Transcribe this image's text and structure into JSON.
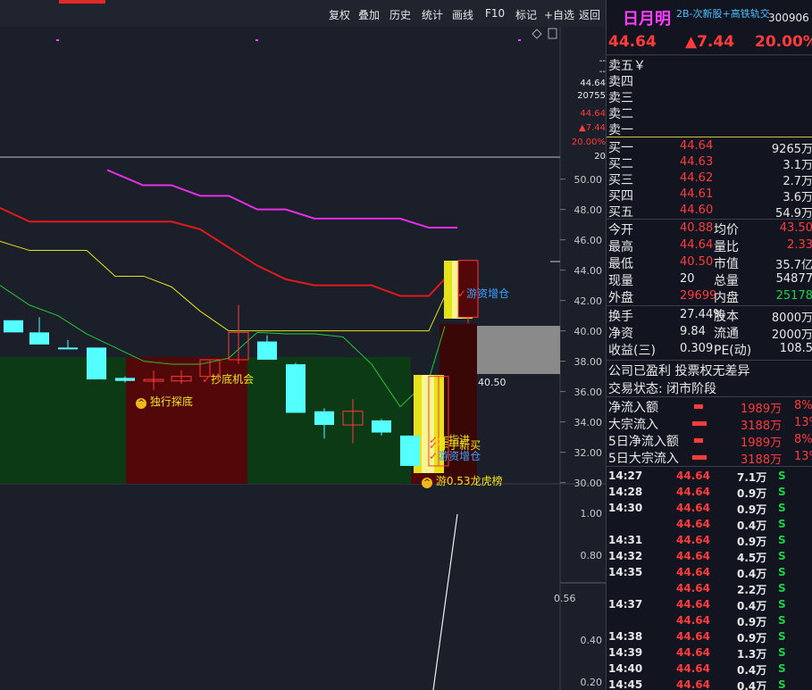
{
  "toolbar": {
    "items": [
      "复权",
      "叠加",
      "历史",
      "统计",
      "画线",
      "F10",
      "标记",
      "+自选",
      "返回"
    ]
  },
  "stock": {
    "name": "日月明",
    "tags": "2B-次新股+高铁轨交",
    "code": "300906",
    "price": "44.64",
    "change": "▲7.44",
    "pct": "20.00%"
  },
  "chart_info": {
    "dashes": [
      "--",
      "--"
    ],
    "values": [
      "44.64",
      "20755",
      "44.64",
      "▲7.44",
      "20.00%",
      "20"
    ]
  },
  "price_axis": [
    "50.00",
    "48.00",
    "46.00",
    "44.00",
    "42.00",
    "40.00",
    "38.00",
    "36.00",
    "34.00",
    "32.00",
    "30.00"
  ],
  "sub_axis": [
    "1.00",
    "0.80",
    "0.56",
    "0.40",
    "0.20"
  ],
  "signals": {
    "dujia": "独行探底",
    "chaodi": "抄底机会",
    "youzi1": "游资增仓",
    "zuoshou": "作手新买",
    "baoyi": "作指进",
    "youzi2": "游资增仓",
    "longhu": "龙虎榜",
    "price_label": "40.50",
    "extra": "游0.53"
  },
  "orderbook": {
    "sell": [
      {
        "label": "卖五",
        "price": "￥",
        "vol": ""
      },
      {
        "label": "卖四",
        "price": "",
        "vol": ""
      },
      {
        "label": "卖三",
        "price": "",
        "vol": ""
      },
      {
        "label": "卖二",
        "price": "",
        "vol": ""
      },
      {
        "label": "卖一",
        "price": "",
        "vol": ""
      }
    ],
    "buy": [
      {
        "label": "买一",
        "price": "44.64",
        "vol": "9265万"
      },
      {
        "label": "买二",
        "price": "44.63",
        "vol": "3.1万"
      },
      {
        "label": "买三",
        "price": "44.62",
        "vol": "2.7万"
      },
      {
        "label": "买四",
        "price": "44.61",
        "vol": "3.6万"
      },
      {
        "label": "买五",
        "price": "44.60",
        "vol": "54.9万"
      }
    ]
  },
  "stats": [
    {
      "l1": "今开",
      "v1": "40.88",
      "c1": "red",
      "l2": "均价",
      "v2": "43.50",
      "c2": "red"
    },
    {
      "l1": "最高",
      "v1": "44.64",
      "c1": "red",
      "l2": "量比",
      "v2": "2.33",
      "c2": "red"
    },
    {
      "l1": "最低",
      "v1": "40.50",
      "c1": "red",
      "l2": "市值",
      "v2": "35.7亿",
      "c2": "white"
    },
    {
      "l1": "现量",
      "v1": "20",
      "c1": "white",
      "l2": "总量",
      "v2": "54877",
      "c2": "white"
    },
    {
      "l1": "外盘",
      "v1": "29699",
      "c1": "red",
      "l2": "内盘",
      "v2": "25178",
      "c2": "green"
    }
  ],
  "stats2": [
    {
      "l1": "换手",
      "v1": "27.44%",
      "l2": "股本",
      "v2": "8000万"
    },
    {
      "l1": "净资",
      "v1": "9.84",
      "l2": "流通",
      "v2": "2000万"
    },
    {
      "l1": "收益(三)",
      "v1": "0.309",
      "l2": "PE(动)",
      "v2": "108.5"
    }
  ],
  "notes": {
    "line1": "公司已盈利 投票权无差异",
    "line2": "交易状态: 闭市阶段"
  },
  "flows": [
    {
      "label": "净流入额",
      "value": "1989万",
      "pct": "8%"
    },
    {
      "label": "大宗流入",
      "value": "3188万",
      "pct": "13%"
    },
    {
      "label": "5日净流入额",
      "value": "1989万",
      "pct": "8%"
    },
    {
      "label": "5日大宗流入",
      "value": "3188万",
      "pct": "13%"
    }
  ],
  "ticks": [
    {
      "time": "14:27",
      "price": "44.64",
      "vol": "7.1万",
      "side": "S"
    },
    {
      "time": "14:28",
      "price": "44.64",
      "vol": "0.9万",
      "side": "S"
    },
    {
      "time": "14:30",
      "price": "44.64",
      "vol": "0.9万",
      "side": "S"
    },
    {
      "time": "",
      "price": "44.64",
      "vol": "0.4万",
      "side": "S"
    },
    {
      "time": "14:31",
      "price": "44.64",
      "vol": "0.9万",
      "side": "S"
    },
    {
      "time": "14:32",
      "price": "44.64",
      "vol": "4.5万",
      "side": "S"
    },
    {
      "time": "14:35",
      "price": "44.64",
      "vol": "0.4万",
      "side": "S"
    },
    {
      "time": "",
      "price": "44.64",
      "vol": "2.2万",
      "side": "S"
    },
    {
      "time": "14:37",
      "price": "44.64",
      "vol": "0.4万",
      "side": "S"
    },
    {
      "time": "",
      "price": "44.64",
      "vol": "0.9万",
      "side": "S"
    },
    {
      "time": "14:38",
      "price": "44.64",
      "vol": "0.9万",
      "side": "S"
    },
    {
      "time": "14:39",
      "price": "44.64",
      "vol": "1.3万",
      "side": "S"
    },
    {
      "time": "14:40",
      "price": "44.64",
      "vol": "0.4万",
      "side": "S"
    },
    {
      "time": "14:45",
      "price": "44.64",
      "vol": "0.4万",
      "side": "S"
    }
  ],
  "colors": {
    "up": "#ff3b3b",
    "down": "#1cd14a",
    "bg": "#1b1f29",
    "panel": "#121520"
  },
  "chart_data": {
    "type": "candlestick",
    "y_range": [
      30,
      50.6
    ],
    "candles": [
      {
        "x": 4,
        "open": 40.7,
        "close": 39.9,
        "high": 40.7,
        "low": 39.9
      },
      {
        "x": 33,
        "open": 39.9,
        "close": 39.1,
        "high": 40.9,
        "low": 39.1
      },
      {
        "x": 65,
        "open": 38.9,
        "close": 38.8,
        "high": 39.4,
        "low": 38.8
      },
      {
        "x": 97,
        "open": 38.9,
        "close": 36.8,
        "high": 38.9,
        "low": 36.8
      },
      {
        "x": 129,
        "open": 36.9,
        "close": 36.7,
        "high": 37.0,
        "low": 36.6
      },
      {
        "x": 161,
        "open": 36.7,
        "close": 36.8,
        "high": 37.4,
        "low": 36.1
      },
      {
        "x": 192,
        "open": 36.7,
        "close": 37.0,
        "high": 37.4,
        "low": 36.5
      },
      {
        "x": 224,
        "open": 37.0,
        "close": 38.1,
        "high": 38.1,
        "low": 37.0
      },
      {
        "x": 256,
        "open": 38.1,
        "close": 39.9,
        "high": 41.7,
        "low": 37.8
      },
      {
        "x": 288,
        "open": 39.3,
        "close": 38.1,
        "high": 39.7,
        "low": 38.1
      },
      {
        "x": 320,
        "open": 37.8,
        "close": 34.6,
        "high": 37.9,
        "low": 34.6
      },
      {
        "x": 352,
        "open": 34.7,
        "close": 33.8,
        "high": 34.9,
        "low": 32.9
      },
      {
        "x": 384,
        "open": 33.8,
        "close": 34.7,
        "high": 35.5,
        "low": 32.6
      },
      {
        "x": 416,
        "open": 34.1,
        "close": 33.3,
        "high": 34.2,
        "low": 33.1
      },
      {
        "x": 448,
        "open": 33.1,
        "close": 31.1,
        "high": 33.1,
        "low": 31.1
      },
      {
        "x": 480,
        "open": 31.1,
        "close": 37.0,
        "high": 37.0,
        "low": 31.1
      },
      {
        "x": 513,
        "open": 40.9,
        "close": 44.64,
        "high": 44.64,
        "low": 40.5
      }
    ],
    "lines": {
      "magenta": [
        [
          120,
          50.6
        ],
        [
          160,
          49.6
        ],
        [
          192,
          49.6
        ],
        [
          224,
          48.9
        ],
        [
          256,
          48.9
        ],
        [
          288,
          48.0
        ],
        [
          320,
          48.0
        ],
        [
          352,
          47.4
        ],
        [
          384,
          47.4
        ],
        [
          416,
          47.4
        ],
        [
          448,
          47.4
        ],
        [
          480,
          46.8
        ],
        [
          512,
          46.8
        ]
      ],
      "red": [
        [
          0,
          48.1
        ],
        [
          33,
          47.2
        ],
        [
          65,
          47.2
        ],
        [
          97,
          47.2
        ],
        [
          129,
          47.2
        ],
        [
          161,
          47.2
        ],
        [
          192,
          47.2
        ],
        [
          224,
          46.7
        ],
        [
          256,
          45.5
        ],
        [
          288,
          44.3
        ],
        [
          320,
          43.4
        ],
        [
          352,
          43.0
        ],
        [
          384,
          43.0
        ],
        [
          416,
          43.0
        ],
        [
          448,
          42.3
        ],
        [
          480,
          42.3
        ],
        [
          512,
          44.3
        ]
      ],
      "yellow": [
        [
          0,
          45.9
        ],
        [
          33,
          45.3
        ],
        [
          65,
          45.3
        ],
        [
          97,
          45.3
        ],
        [
          129,
          43.6
        ],
        [
          161,
          43.6
        ],
        [
          192,
          42.9
        ],
        [
          224,
          41.3
        ],
        [
          256,
          40.0
        ],
        [
          288,
          40.0
        ],
        [
          320,
          40.0
        ],
        [
          352,
          40.0
        ],
        [
          384,
          40.0
        ],
        [
          416,
          40.0
        ],
        [
          448,
          40.0
        ],
        [
          480,
          40.0
        ],
        [
          498,
          42.3
        ]
      ],
      "green": [
        [
          0,
          43.0
        ],
        [
          33,
          41.7
        ],
        [
          65,
          41.0
        ],
        [
          97,
          39.8
        ],
        [
          129,
          38.9
        ],
        [
          161,
          38.0
        ],
        [
          192,
          37.8
        ],
        [
          224,
          37.8
        ],
        [
          256,
          38.2
        ],
        [
          288,
          39.9
        ],
        [
          320,
          39.8
        ],
        [
          352,
          39.8
        ],
        [
          384,
          39.6
        ],
        [
          416,
          37.8
        ],
        [
          448,
          35.0
        ],
        [
          480,
          36.8
        ],
        [
          498,
          40.3
        ]
      ]
    }
  }
}
